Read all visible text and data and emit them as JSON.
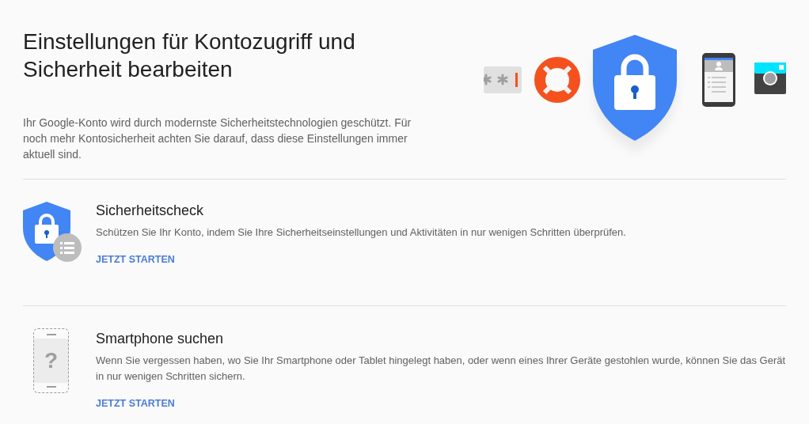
{
  "header": {
    "title": "Einstellungen für Kontozugriff und Sicherheit bearbeiten",
    "description": "Ihr Google-Konto wird durch modernste Sicherheitstechnologien geschützt. Für noch mehr Kontosicherheit achten Sie darauf, dass diese Einstellungen immer aktuell sind."
  },
  "sections": [
    {
      "kind": "security",
      "title": "Sicherheitscheck",
      "description": "Schützen Sie Ihr Konto, indem Sie Ihre Sicherheitseinstellungen und Aktivitäten in nur wenigen Schritten überprüfen.",
      "link": "JETZT STARTEN"
    },
    {
      "kind": "phone",
      "icon_glyph": "?",
      "title": "Smartphone suchen",
      "description": "Wenn Sie vergessen haben, wo Sie Ihr Smartphone oder Tablet hingelegt haben, oder wenn eines Ihrer Geräte gestohlen wurde, können Sie das Gerät in nur wenigen Schritten sichern.",
      "link": "JETZT STARTEN"
    }
  ]
}
